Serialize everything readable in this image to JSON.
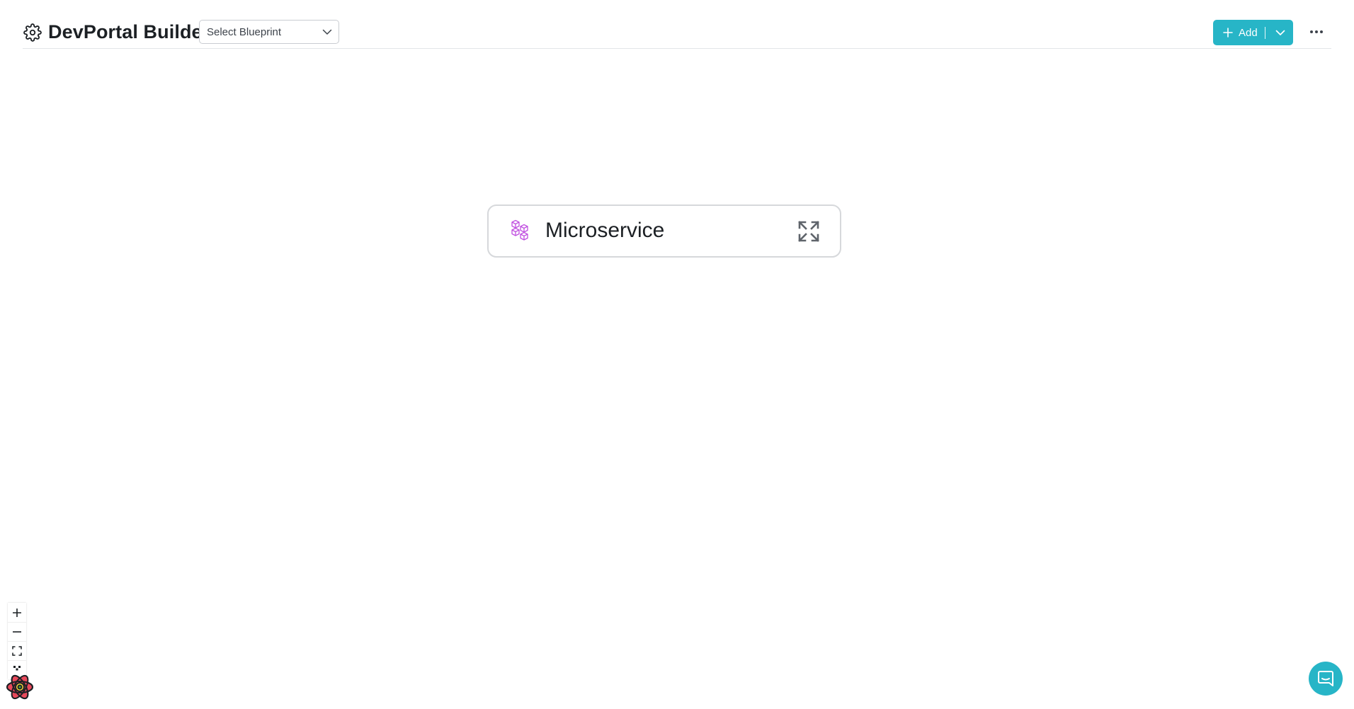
{
  "header": {
    "title": "DevPortal Builder",
    "blueprint_select": {
      "selected": "Select Blueprint"
    },
    "add_button": {
      "label": "Add"
    }
  },
  "canvas": {
    "nodes": [
      {
        "label": "Microservice",
        "icon": "cubes-icon",
        "action_icon": "expand-icon"
      }
    ]
  },
  "controls": {
    "zoom": [
      "zoom-in-icon",
      "zoom-out-icon",
      "fit-view-icon",
      "toggle-interactivity-icon"
    ]
  },
  "colors": {
    "accent": "#27b5c7",
    "node_icon": "#c150e0",
    "node_border": "#d6d8db"
  }
}
